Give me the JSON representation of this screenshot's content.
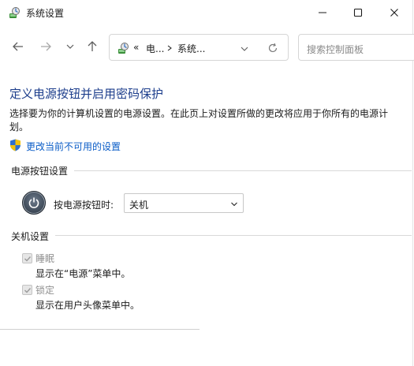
{
  "window": {
    "title": "系统设置",
    "minimize_icon": "minimize-icon",
    "maximize_icon": "maximize-icon",
    "close_icon": "close-icon"
  },
  "nav": {
    "back_icon": "arrow-left-icon",
    "forward_icon": "arrow-right-icon",
    "recent_icon": "chevron-down-icon",
    "up_icon": "arrow-up-icon",
    "breadcrumb_overflow": "«",
    "breadcrumb": [
      "电...",
      "系统..."
    ],
    "refresh_icon": "refresh-icon",
    "search_placeholder": "搜索控制面板"
  },
  "page": {
    "heading": "定义电源按钮并启用密码保护",
    "description": "选择要为你的计算机设置的电源设置。在此页上对设置所做的更改将应用于你所有的电源计划。",
    "change_link": "更改当前不可用的设置",
    "power_section": {
      "title": "电源按钮设置",
      "label": "按电源按钮时:",
      "selected": "关机"
    },
    "shutdown_section": {
      "title": "关机设置",
      "items": [
        {
          "label": "睡眠",
          "description": "显示在“电源”菜单中。",
          "checked": true
        },
        {
          "label": "锁定",
          "description": "显示在用户头像菜单中。",
          "checked": true
        }
      ]
    }
  },
  "colors": {
    "heading": "#1d3e8c",
    "link": "#0a5cc7",
    "disabled_text": "#8f8f8f"
  }
}
